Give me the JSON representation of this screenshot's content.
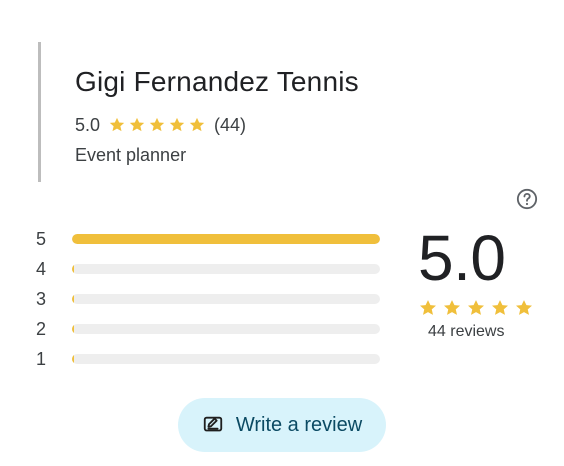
{
  "place": {
    "name": "Gigi Fernandez Tennis",
    "rating": "5.0",
    "review_count_short": "(44)",
    "category": "Event planner",
    "stars_count": 5
  },
  "summary": {
    "average": "5.0",
    "reviews_text": "44 reviews"
  },
  "breakdown": [
    {
      "label": "5",
      "fraction": 1.0
    },
    {
      "label": "4",
      "fraction": 0.0
    },
    {
      "label": "3",
      "fraction": 0.0
    },
    {
      "label": "2",
      "fraction": 0.0
    },
    {
      "label": "1",
      "fraction": 0.0
    }
  ],
  "actions": {
    "write_review_label": "Write a review"
  },
  "icons": {
    "help": "help-circle-icon",
    "write_review": "edit-review-icon",
    "star": "star-icon"
  },
  "colors": {
    "star": "#f0bf3b",
    "bar_track": "#eeeeee",
    "bar_fill": "#f0bf3b",
    "button_bg": "#d8f3fb",
    "button_text": "#0b4a63"
  }
}
